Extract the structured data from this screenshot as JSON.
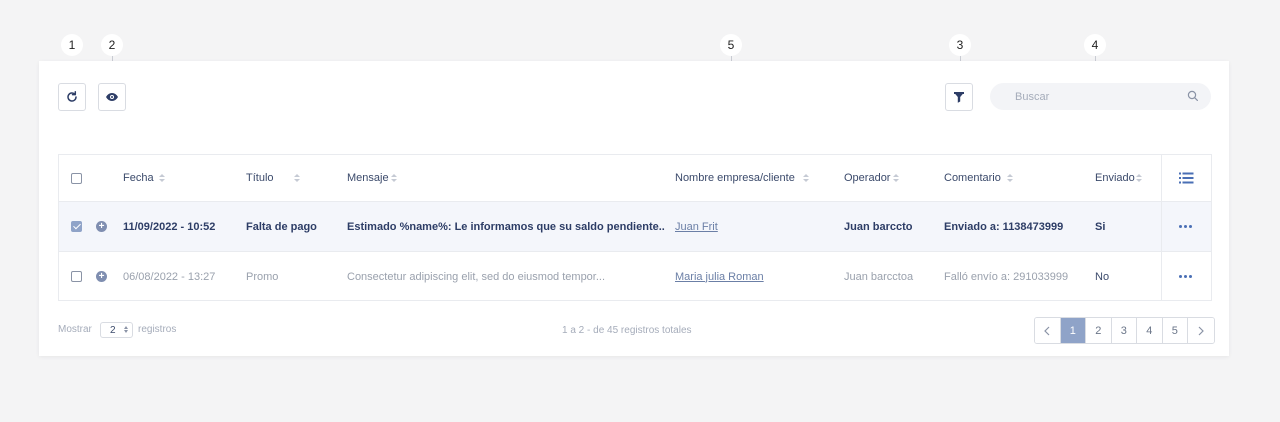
{
  "callouts": [
    "1",
    "2",
    "3",
    "4",
    "5"
  ],
  "toolbar": {
    "refresh_icon": "refresh-icon",
    "view_icon": "eye-icon",
    "filter_icon": "funnel-icon",
    "search_placeholder": "Buscar",
    "search_icon": "search-icon"
  },
  "table": {
    "columns": [
      "Fecha",
      "Título",
      "Mensaje",
      "Nombre empresa/cliente",
      "Operador",
      "Comentario",
      "Enviado"
    ],
    "column_menu_icon": "list-icon",
    "rows": [
      {
        "checked": true,
        "fecha": "11/09/2022 - 10:52",
        "titulo": "Falta de pago",
        "mensaje": "Estimado %name%: Le informamos que su saldo pendiente..",
        "cliente": "Juan Frit",
        "operador": "Juan barccto",
        "comentario": "Enviado a: 1138473999",
        "enviado": "Si"
      },
      {
        "checked": false,
        "fecha": "06/08/2022 - 13:27",
        "titulo": "Promo",
        "mensaje": "Consectetur adipiscing elit, sed do eiusmod tempor...",
        "cliente": "Maria julia Roman",
        "operador": "Juan barcctoa",
        "comentario": "Falló envío a: 291033999",
        "enviado": "No"
      }
    ]
  },
  "footer": {
    "show_label": "Mostrar",
    "show_value": "2",
    "records_label": "registros",
    "summary": "1 a 2 - de 45 registros totales",
    "pages": [
      "1",
      "2",
      "3",
      "4",
      "5"
    ],
    "current_page": "1",
    "prev_icon": "chevron-left-icon",
    "next_icon": "chevron-right-icon"
  },
  "colors": {
    "accent": "#8fa3c8",
    "text_dark": "#2d3d66",
    "text_muted": "#9aa1ad",
    "background": "#f4f4f5"
  }
}
